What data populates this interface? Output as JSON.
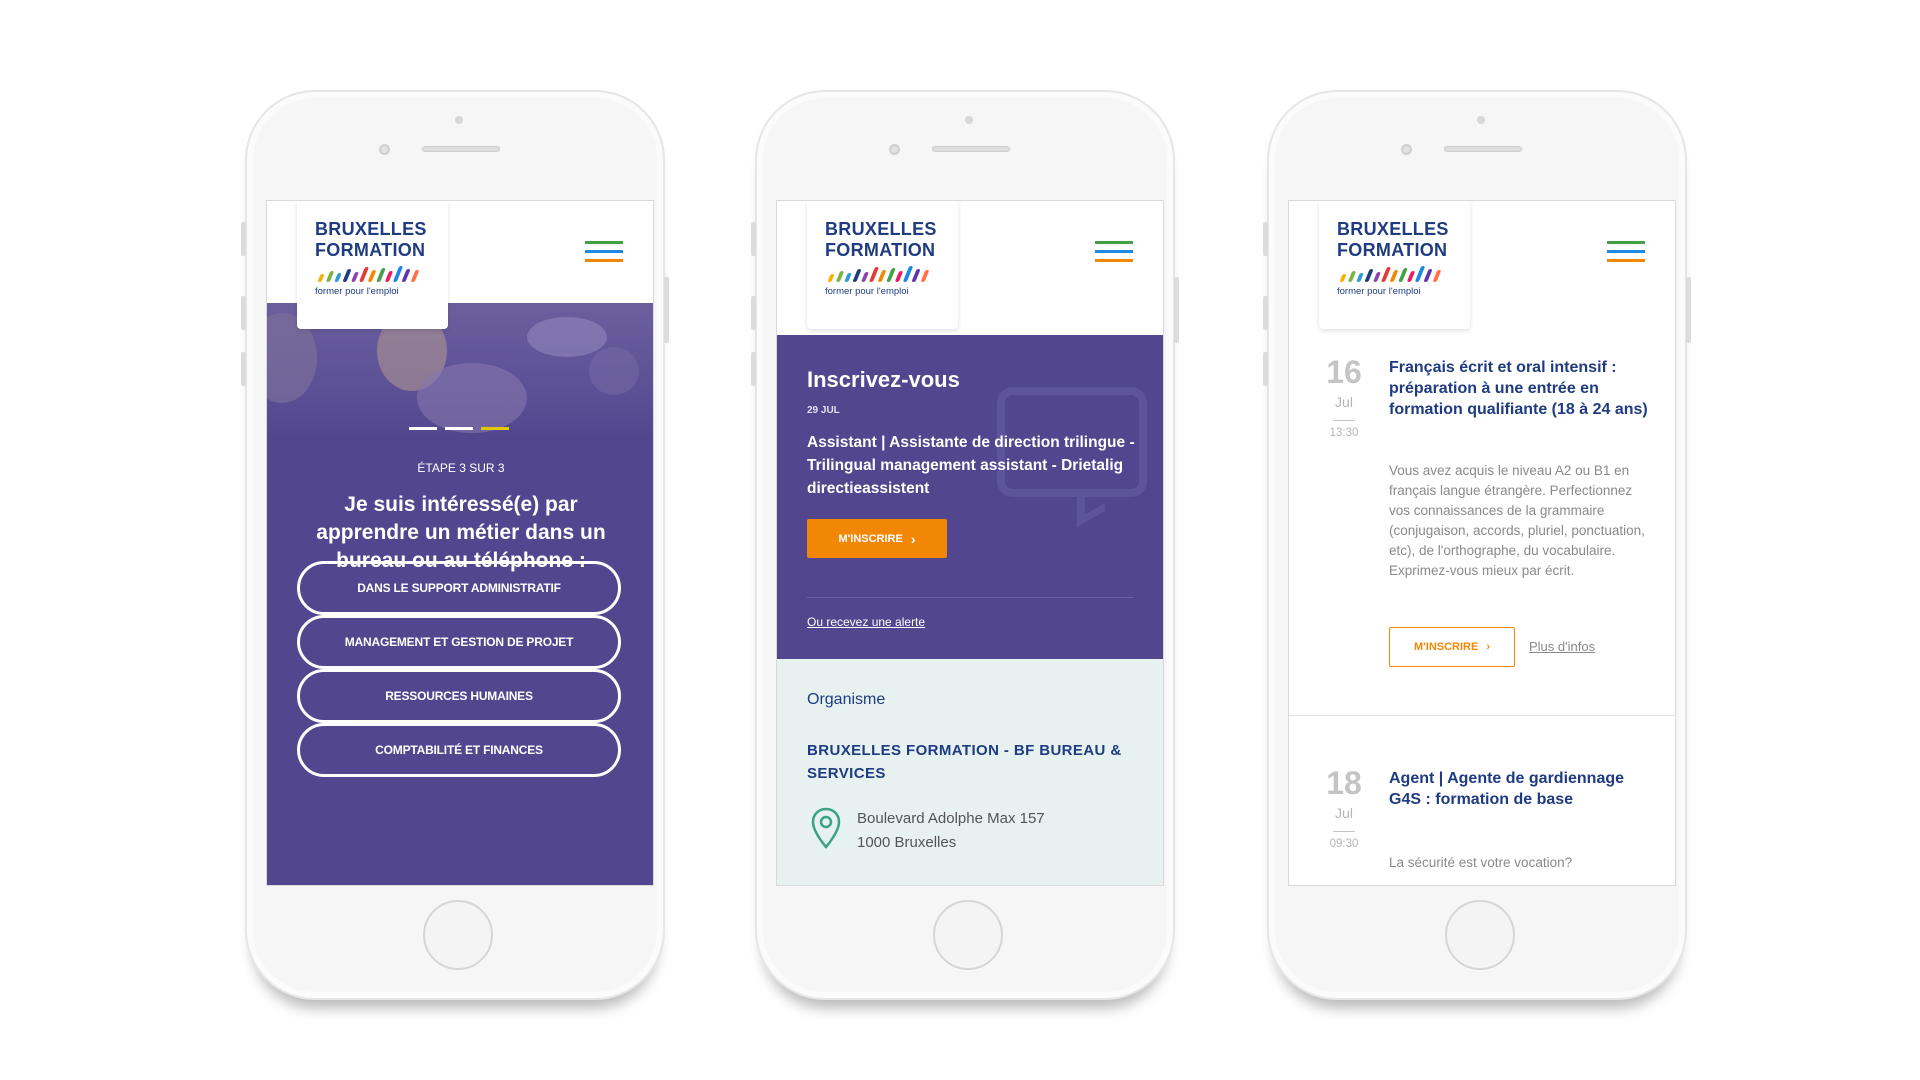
{
  "brand": {
    "line1": "BRUXELLES",
    "line2": "FORMATION",
    "tagline": "former pour l'emploi",
    "stripe_colors": [
      "#f4b400",
      "#7cb342",
      "#2e9bd6",
      "#1f3b82",
      "#8e44ad",
      "#e53935",
      "#f28705",
      "#43a047",
      "#e91e63",
      "#1e88e5",
      "#5e35b1",
      "#ff7043"
    ],
    "menu_colors": [
      "#43a047",
      "#1e88e5",
      "#f28705"
    ],
    "menu_icon": "hamburger-icon"
  },
  "screen1": {
    "carousel_active_index": 2,
    "step_label": "ÉTAPE 3 SUR 3",
    "title": "Je suis intéressé(e) par apprendre un métier dans un bureau ou au téléphone :",
    "options": [
      "DANS LE SUPPORT ADMINISTRATIF",
      "MANAGEMENT ET GESTION DE PROJET",
      "RESSOURCES HUMAINES",
      "COMPTABILITÉ ET FINANCES"
    ]
  },
  "screen2": {
    "heading": "Inscrivez-vous",
    "date": "29 JUL",
    "course_title": "Assistant | Assistante de direction trilingue - Trilingual management assistant - Drietalig directieassistent",
    "register_button": "M'INSCRIRE",
    "alert_link": "Ou recevez une alerte",
    "organism_heading": "Organisme",
    "organism_name": "BRUXELLES FORMATION - BF BUREAU & SERVICES",
    "address_line1": "Boulevard Adolphe Max 157",
    "address_line2": "1000 Bruxelles",
    "pin_icon": "location-pin-icon"
  },
  "screen3": {
    "events": [
      {
        "day": "16",
        "month": "Jul",
        "time": "13:30",
        "title": "Français écrit et oral intensif : préparation à une entrée en formation qualifiante (18 à 24 ans)",
        "description": "Vous avez acquis le niveau A2 ou B1 en français langue étrangère. Perfectionnez vos connaissances de la grammaire (conjugaison, accords, pluriel, ponctuation, etc), de l'orthographe, du vocabulaire. Exprimez-vous mieux par écrit.",
        "register_button": "M'INSCRIRE",
        "more_link": "Plus d'infos"
      },
      {
        "day": "18",
        "month": "Jul",
        "time": "09:30",
        "title": "Agent | Agente de gardiennage G4S : formation de base",
        "description": "La sécurité est votre vocation?"
      }
    ]
  },
  "colors": {
    "purple": "#52478e",
    "navy": "#1f3b82",
    "orange": "#f28705",
    "mint": "#e6f1f0",
    "dot_active": "#e3c700"
  }
}
